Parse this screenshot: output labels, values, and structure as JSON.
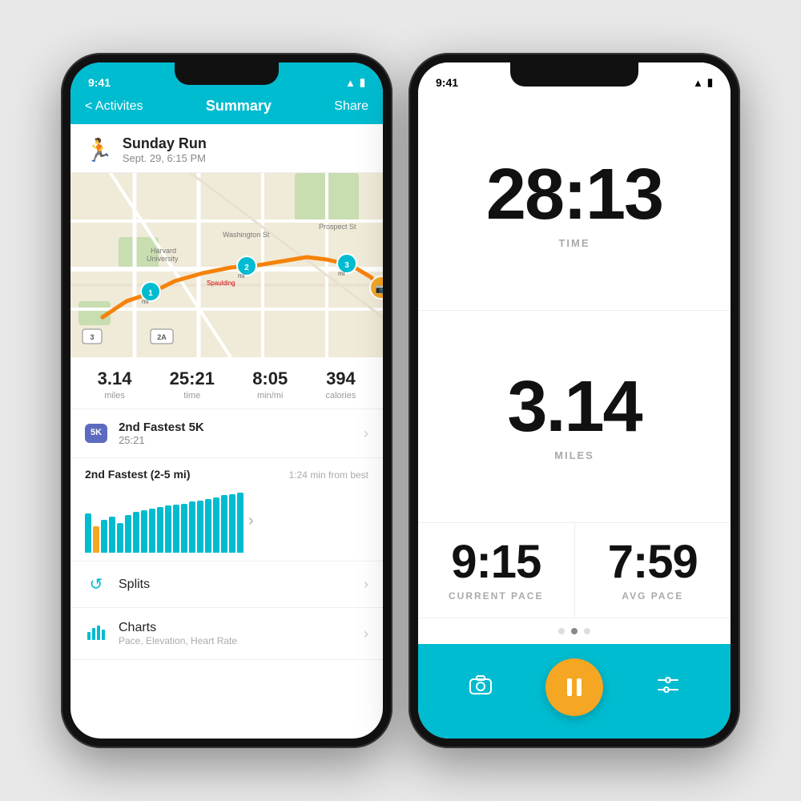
{
  "left_phone": {
    "status": {
      "time": "9:41",
      "icons": [
        "wifi",
        "battery"
      ]
    },
    "nav": {
      "back_label": "< Activites",
      "title": "Summary",
      "action": "Share"
    },
    "activity": {
      "title": "Sunday Run",
      "date": "Sept. 29, 6:15 PM"
    },
    "stats": [
      {
        "value": "3.14",
        "label": "miles"
      },
      {
        "value": "25:21",
        "label": "time"
      },
      {
        "value": "8:05",
        "label": "min/mi"
      },
      {
        "value": "394",
        "label": "calories"
      }
    ],
    "pr": {
      "badge": "5K",
      "title": "2nd Fastest 5K",
      "time": "25:21"
    },
    "chart": {
      "title": "2nd Fastest (2-5 mi)",
      "subtitle": "1:24 min from best",
      "bars": [
        60,
        40,
        50,
        55,
        45,
        58,
        62,
        65,
        68,
        70,
        72,
        74,
        75,
        78,
        80,
        82,
        85,
        88,
        90,
        92
      ],
      "highlight_index": 1
    },
    "menu_items": [
      {
        "icon": "⟳",
        "title": "Splits",
        "subtitle": ""
      },
      {
        "icon": "📊",
        "title": "Charts",
        "subtitle": "Pace, Elevation, Heart Rate"
      }
    ]
  },
  "right_phone": {
    "status": {
      "time": "9:41"
    },
    "time_display": "28:13",
    "time_label": "TIME",
    "distance_display": "3.14",
    "distance_label": "MILES",
    "current_pace": "9:15",
    "current_pace_label": "CURRENT PACE",
    "avg_pace": "7:59",
    "avg_pace_label": "AVG PACE",
    "dots": [
      false,
      true,
      false
    ],
    "controls": {
      "camera_icon": "📷",
      "pause_icon": "⏸",
      "settings_icon": "⚙"
    }
  }
}
